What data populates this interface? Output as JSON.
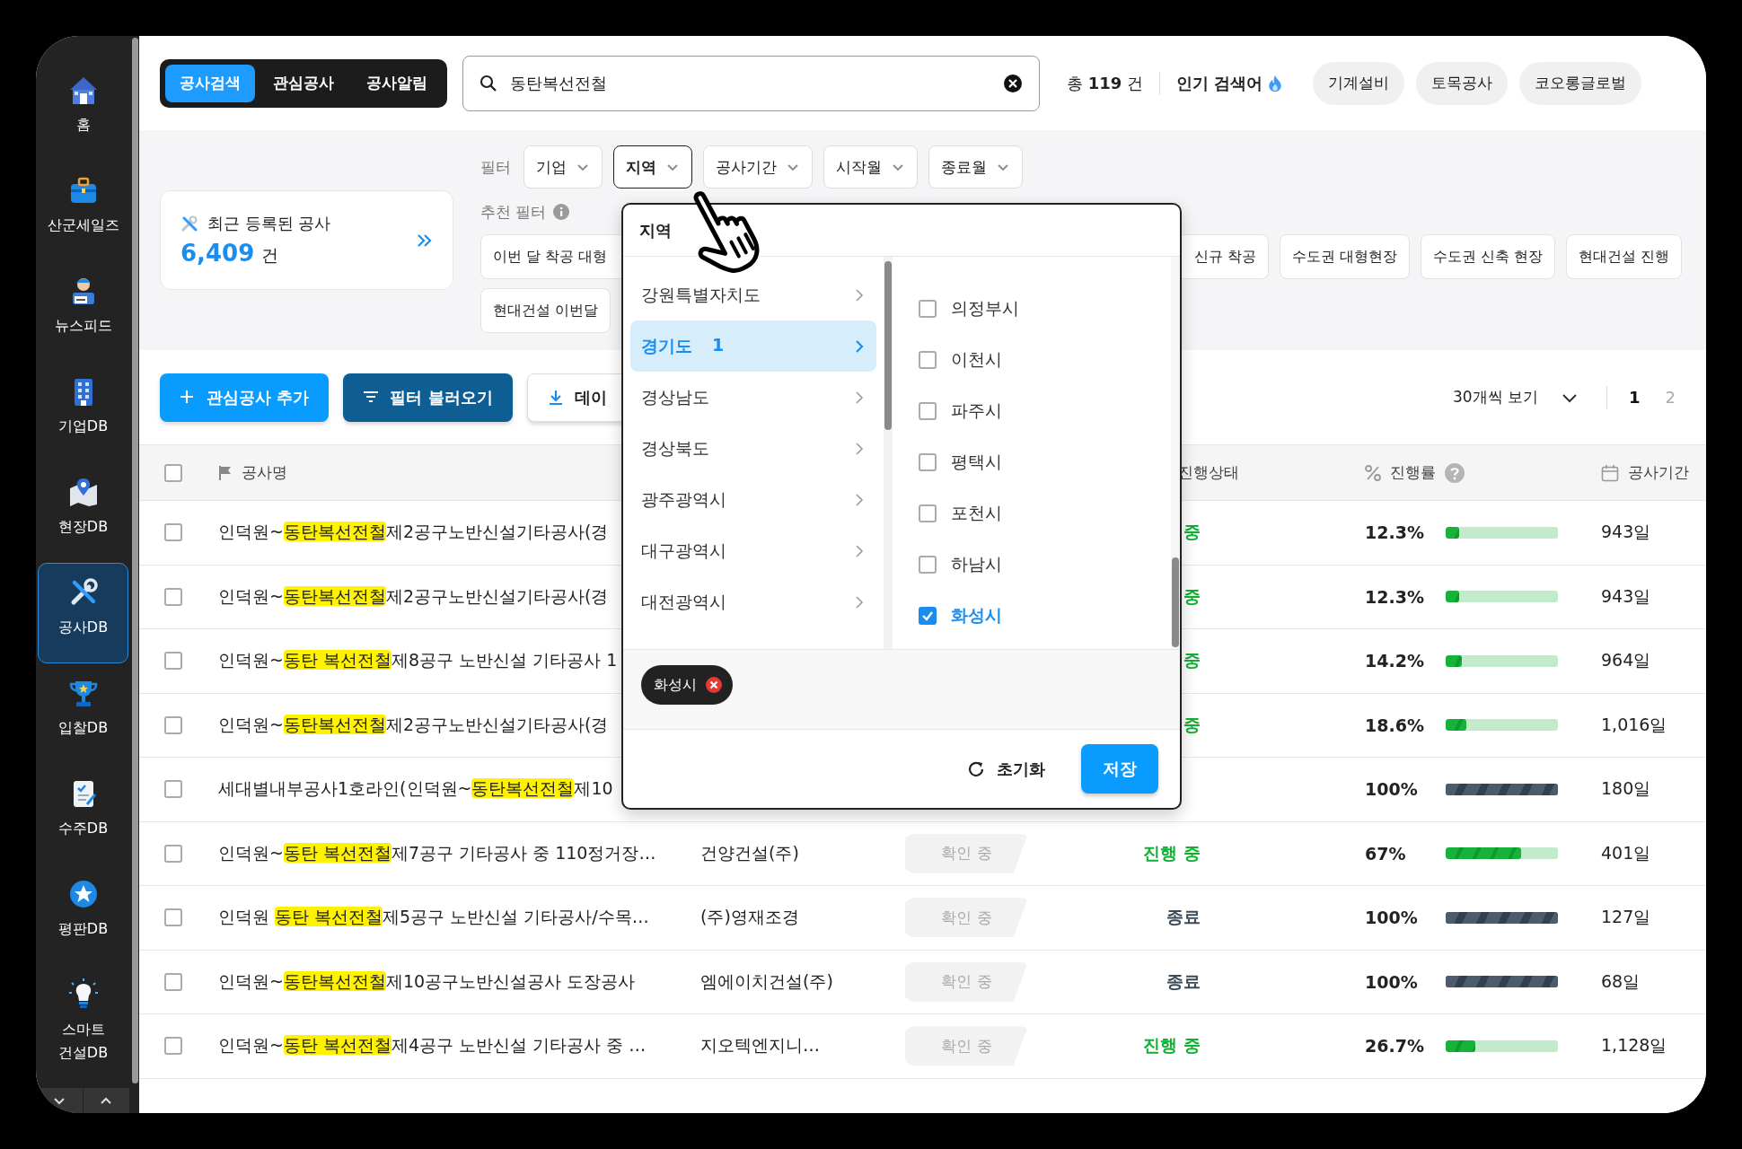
{
  "sidebar": {
    "items": [
      {
        "label": "홈",
        "selected": false
      },
      {
        "label": "산군세일즈",
        "selected": false
      },
      {
        "label": "뉴스피드",
        "selected": false
      },
      {
        "label": "기업DB",
        "selected": false
      },
      {
        "label": "현장DB",
        "selected": false
      },
      {
        "label": "공사DB",
        "selected": true
      },
      {
        "label": "입찰DB",
        "selected": false
      },
      {
        "label": "수주DB",
        "selected": false
      },
      {
        "label": "평판DB",
        "selected": false
      },
      {
        "label": "스마트 건설DB",
        "selected": false
      }
    ]
  },
  "top_bar": {
    "tabs": [
      {
        "label": "공사검색",
        "selected": true
      },
      {
        "label": "관심공사",
        "selected": false
      },
      {
        "label": "공사알림",
        "selected": false
      }
    ],
    "search": {
      "value": "동탄복선전철"
    },
    "total": "총 **119** 건",
    "popular_label": "인기 검색어",
    "popular_chips": [
      "기계설비",
      "토목공사",
      "코오롱글로벌"
    ]
  },
  "filters": {
    "label": "필터",
    "dropdowns": [
      {
        "label": "기업",
        "open": false
      },
      {
        "label": "지역",
        "open": true
      },
      {
        "label": "공사기간",
        "open": false
      },
      {
        "label": "시작월",
        "open": false
      },
      {
        "label": "종료월",
        "open": false
      }
    ]
  },
  "recent_card": {
    "title": "최근 등록된 공사",
    "count": "6,409",
    "unit": "건"
  },
  "recommended": {
    "label": "추천 필터",
    "chip_rows": [
      [
        "이번 달 착공 대형",
        "신규 착공",
        "수도권 대형현장",
        "수도권 신축 현장",
        "현대건설 진행"
      ],
      [
        "현대건설 이번달"
      ]
    ]
  },
  "actions": {
    "buttons": [
      {
        "label": "관심공사 추가",
        "kind": "primary"
      },
      {
        "label": "필터 불러오기",
        "kind": "dark"
      },
      {
        "label": "데이",
        "kind": "outline"
      }
    ],
    "page_size": "30개씩 보기",
    "pages": [
      {
        "label": "1",
        "selected": true
      },
      {
        "label": "2",
        "selected": false
      }
    ]
  },
  "table": {
    "select_all": {
      "checked": false
    },
    "columns": [
      {
        "label": "공사명"
      },
      {
        "label": "진행상태"
      },
      {
        "label": "진행률"
      },
      {
        "label": "공사기간"
      }
    ],
    "rows": [
      {
        "checked": false,
        "name": [
          {
            "text": "인덕원~",
            "highlight": false
          },
          {
            "text": "동탄복선전철",
            "highlight": true
          },
          {
            "text": "제2공구노반신설기타공사(경",
            "highlight": false
          }
        ],
        "status": "중",
        "finished": false,
        "progress": "12.3%",
        "level": 0.123,
        "duration": "943일"
      },
      {
        "checked": false,
        "name": [
          {
            "text": "인덕원~",
            "highlight": false
          },
          {
            "text": "동탄복선전철",
            "highlight": true
          },
          {
            "text": "제2공구노반신설기타공사(경",
            "highlight": false
          }
        ],
        "status": "중",
        "finished": false,
        "progress": "12.3%",
        "level": 0.123,
        "duration": "943일"
      },
      {
        "checked": false,
        "name": [
          {
            "text": "인덕원~",
            "highlight": false
          },
          {
            "text": "동탄 복선전철",
            "highlight": true
          },
          {
            "text": "제8공구 노반신설 기타공사 1",
            "highlight": false
          }
        ],
        "status": "중",
        "finished": false,
        "progress": "14.2%",
        "level": 0.142,
        "duration": "964일"
      },
      {
        "checked": false,
        "name": [
          {
            "text": "인덕원~",
            "highlight": false
          },
          {
            "text": "동탄복선전철",
            "highlight": true
          },
          {
            "text": "제2공구노반신설기타공사(경",
            "highlight": false
          }
        ],
        "status": "중",
        "finished": false,
        "progress": "18.6%",
        "level": 0.186,
        "duration": "1,016일"
      },
      {
        "checked": false,
        "name": [
          {
            "text": "세대별내부공사1호라인(인덕원~",
            "highlight": false
          },
          {
            "text": "동탄복선전철",
            "highlight": true
          },
          {
            "text": "제10",
            "highlight": false
          }
        ],
        "finished": true,
        "progress": "100%",
        "level": 1,
        "duration": "180일"
      },
      {
        "checked": false,
        "name": [
          {
            "text": "인덕원~",
            "highlight": false
          },
          {
            "text": "동탄 복선전철",
            "highlight": true
          },
          {
            "text": "제7공구 기타공사 중 110정거장…",
            "highlight": false
          }
        ],
        "company": "건양건설(주)",
        "review": "확인 중",
        "status": "진행 중",
        "finished": false,
        "progress": "67%",
        "level": 0.67,
        "duration": "401일"
      },
      {
        "checked": false,
        "name": [
          {
            "text": "인덕원 ",
            "highlight": false
          },
          {
            "text": "동탄 복선전철",
            "highlight": true
          },
          {
            "text": "제5공구 노반신설 기타공사/수목…",
            "highlight": false
          }
        ],
        "company": "(주)영재조경",
        "review": "확인 중",
        "status": "종료",
        "finished": true,
        "progress": "100%",
        "level": 1,
        "duration": "127일"
      },
      {
        "checked": false,
        "name": [
          {
            "text": "인덕원~",
            "highlight": false
          },
          {
            "text": "동탄복선전철",
            "highlight": true
          },
          {
            "text": "제10공구노반신설공사 도장공사",
            "highlight": false
          }
        ],
        "company": "엠에이치건설(주)",
        "review": "확인 중",
        "status": "종료",
        "finished": true,
        "progress": "100%",
        "level": 1,
        "duration": "68일"
      },
      {
        "checked": false,
        "name": [
          {
            "text": "인덕원~",
            "highlight": false
          },
          {
            "text": "동탄 복선전철",
            "highlight": true
          },
          {
            "text": "제4공구 노반신설 기타공사 중 …",
            "highlight": false
          }
        ],
        "company": "지오텍엔지니…",
        "review": "확인 중",
        "status": "진행 중",
        "finished": false,
        "progress": "26.7%",
        "level": 0.267,
        "duration": "1,128일"
      }
    ]
  },
  "region_popup": {
    "title": "지역",
    "provinces": [
      {
        "label": "강원특별자치도",
        "selected": false
      },
      {
        "label": "경기도",
        "count": "1",
        "selected": true
      },
      {
        "label": "경상남도",
        "selected": false
      },
      {
        "label": "경상북도",
        "selected": false
      },
      {
        "label": "광주광역시",
        "selected": false
      },
      {
        "label": "대구광역시",
        "selected": false
      },
      {
        "label": "대전광역시",
        "selected": false
      }
    ],
    "cities": [
      {
        "label": "의정부시",
        "checked": false
      },
      {
        "label": "이천시",
        "checked": false
      },
      {
        "label": "파주시",
        "checked": false
      },
      {
        "label": "평택시",
        "checked": false
      },
      {
        "label": "포천시",
        "checked": false
      },
      {
        "label": "하남시",
        "checked": false
      },
      {
        "label": "화성시",
        "checked": true
      }
    ],
    "chosen": [
      "화성시"
    ],
    "reset": "초기화",
    "save": "저장"
  }
}
